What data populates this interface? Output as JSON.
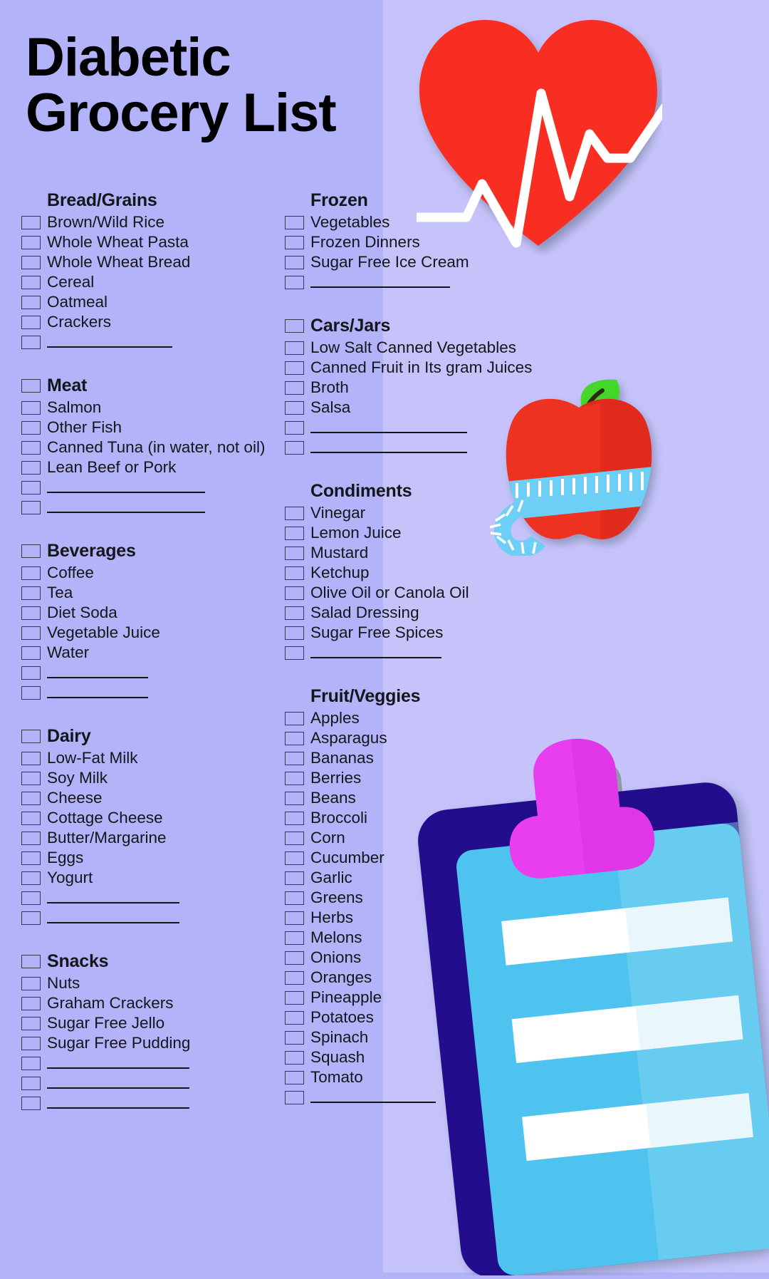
{
  "theme": {
    "bg_left": "#b3b3fa",
    "bg_right": "#c6c3fb",
    "text": "#15151c",
    "heart_red": "#f92d23",
    "apple_red": "#ee3124",
    "leaf_green": "#44d62c",
    "tape_blue": "#6dcff6",
    "clipboard_navy": "#23108c",
    "clipboard_paper": "#4ec3ef",
    "clip_magenta": "#e93df0"
  },
  "title": {
    "line1": "Diabetic",
    "line2": "Grocery List"
  },
  "blank_line": "________________",
  "left_column": [
    {
      "heading": "Bread/Grains",
      "heading_has_checkbox": false,
      "items": [
        {
          "label": "Brown/Wild Rice",
          "blank": false
        },
        {
          "label": "Whole Wheat Pasta",
          "blank": false
        },
        {
          "label": "Whole Wheat Bread",
          "blank": false
        },
        {
          "label": "Cereal",
          "blank": false
        },
        {
          "label": "Oatmeal",
          "blank": false
        },
        {
          "label": "Crackers",
          "blank": false
        },
        {
          "label": "",
          "blank": true,
          "blank_width": 176
        }
      ]
    },
    {
      "heading": "Meat",
      "heading_has_checkbox": true,
      "items": [
        {
          "label": "Salmon",
          "blank": false
        },
        {
          "label": "Other Fish",
          "blank": false
        },
        {
          "label": "Canned Tuna (in water, not oil)",
          "blank": false
        },
        {
          "label": "Lean Beef or Pork",
          "blank": false
        },
        {
          "label": "",
          "blank": true,
          "blank_width": 222
        },
        {
          "label": "",
          "blank": true,
          "blank_width": 222
        }
      ]
    },
    {
      "heading": "Beverages",
      "heading_has_checkbox": true,
      "items": [
        {
          "label": "Coffee",
          "blank": false
        },
        {
          "label": "Tea",
          "blank": false
        },
        {
          "label": "Diet Soda",
          "blank": false
        },
        {
          "label": "Vegetable Juice",
          "blank": false
        },
        {
          "label": "Water",
          "blank": false
        },
        {
          "label": "",
          "blank": true,
          "blank_width": 142
        },
        {
          "label": "",
          "blank": true,
          "blank_width": 142
        }
      ]
    },
    {
      "heading": "Dairy",
      "heading_has_checkbox": true,
      "items": [
        {
          "label": "Low-Fat Milk",
          "blank": false
        },
        {
          "label": "Soy Milk",
          "blank": false
        },
        {
          "label": "Cheese",
          "blank": false
        },
        {
          "label": "Cottage Cheese",
          "blank": false
        },
        {
          "label": "Butter/Margarine",
          "blank": false
        },
        {
          "label": "Eggs",
          "blank": false
        },
        {
          "label": "Yogurt",
          "blank": false
        },
        {
          "label": "",
          "blank": true,
          "blank_width": 186
        },
        {
          "label": "",
          "blank": true,
          "blank_width": 186
        }
      ]
    },
    {
      "heading": "Snacks",
      "heading_has_checkbox": true,
      "items": [
        {
          "label": "Nuts",
          "blank": false
        },
        {
          "label": "Graham Crackers",
          "blank": false
        },
        {
          "label": "Sugar Free Jello",
          "blank": false
        },
        {
          "label": "Sugar Free Pudding",
          "blank": false
        },
        {
          "label": "",
          "blank": true,
          "blank_width": 200
        },
        {
          "label": "",
          "blank": true,
          "blank_width": 200
        },
        {
          "label": "",
          "blank": true,
          "blank_width": 200
        }
      ]
    }
  ],
  "right_column": [
    {
      "heading": "Frozen",
      "heading_has_checkbox": false,
      "items": [
        {
          "label": "Vegetables",
          "blank": false
        },
        {
          "label": "Frozen Dinners",
          "blank": false
        },
        {
          "label": "Sugar Free Ice Cream",
          "blank": false
        },
        {
          "label": "",
          "blank": true,
          "blank_width": 196
        }
      ]
    },
    {
      "heading": "Cars/Jars",
      "heading_has_checkbox": true,
      "items": [
        {
          "label": "Low Salt Canned Vegetables",
          "blank": false
        },
        {
          "label": "Canned Fruit in Its gram Juices",
          "blank": false
        },
        {
          "label": "Broth",
          "blank": false
        },
        {
          "label": "Salsa",
          "blank": false
        },
        {
          "label": "",
          "blank": true,
          "blank_width": 220
        },
        {
          "label": "",
          "blank": true,
          "blank_width": 220
        }
      ]
    },
    {
      "heading": "Condiments",
      "heading_has_checkbox": false,
      "items": [
        {
          "label": "Vinegar",
          "blank": false
        },
        {
          "label": "Lemon Juice",
          "blank": false
        },
        {
          "label": "Mustard",
          "blank": false
        },
        {
          "label": "Ketchup",
          "blank": false
        },
        {
          "label": "Olive Oil or Canola Oil",
          "blank": false
        },
        {
          "label": "Salad Dressing",
          "blank": false
        },
        {
          "label": "Sugar Free Spices",
          "blank": false
        },
        {
          "label": "",
          "blank": true,
          "blank_width": 184
        }
      ]
    },
    {
      "heading": "Fruit/Veggies",
      "heading_has_checkbox": false,
      "items": [
        {
          "label": "Apples",
          "blank": false
        },
        {
          "label": "Asparagus",
          "blank": false
        },
        {
          "label": "Bananas",
          "blank": false
        },
        {
          "label": "Berries",
          "blank": false
        },
        {
          "label": "Beans",
          "blank": false
        },
        {
          "label": "Broccoli",
          "blank": false
        },
        {
          "label": "Corn",
          "blank": false
        },
        {
          "label": "Cucumber",
          "blank": false
        },
        {
          "label": "Garlic",
          "blank": false
        },
        {
          "label": "Greens",
          "blank": false
        },
        {
          "label": "Herbs",
          "blank": false
        },
        {
          "label": "Melons",
          "blank": false
        },
        {
          "label": "Onions",
          "blank": false
        },
        {
          "label": "Oranges",
          "blank": false
        },
        {
          "label": "Pineapple",
          "blank": false
        },
        {
          "label": "Potatoes",
          "blank": false
        },
        {
          "label": "Spinach",
          "blank": false
        },
        {
          "label": "Squash",
          "blank": false
        },
        {
          "label": "Tomato",
          "blank": false
        },
        {
          "label": "",
          "blank": true,
          "blank_width": 176
        }
      ]
    }
  ],
  "illustrations": [
    {
      "name": "heart-with-heartbeat",
      "caption": "Red heart with white EKG pulse line"
    },
    {
      "name": "apple-with-measuring-tape",
      "caption": "Red apple with green leaf wrapped in a blue measuring tape"
    },
    {
      "name": "clipboard-with-checklist",
      "caption": "Navy clipboard with magenta clip and cyan paper"
    }
  ]
}
